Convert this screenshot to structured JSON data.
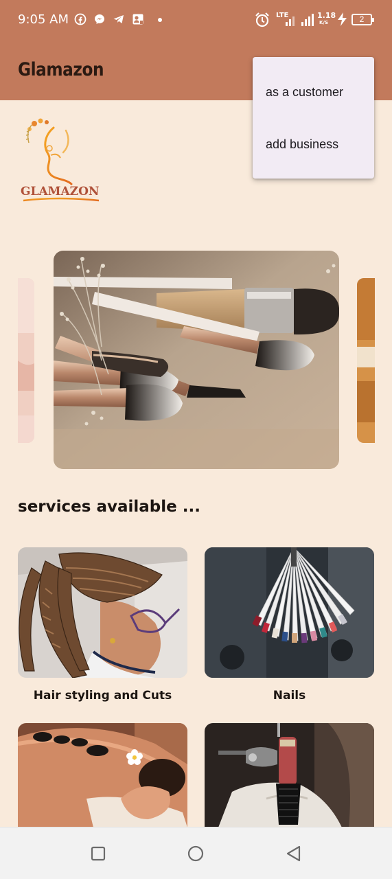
{
  "status_bar": {
    "time": "9:05 AM",
    "network_type": "LTE",
    "speed_value": "1.18",
    "speed_unit": "K/S",
    "battery_level": "2",
    "icons": [
      "facebook-icon",
      "messenger-icon",
      "telegram-icon",
      "contact-card-icon",
      "alarm-icon",
      "signal-icon",
      "charging-icon"
    ]
  },
  "app_bar": {
    "title": "Glamazon",
    "background_color": "#c27a5c"
  },
  "popup_menu": {
    "items": [
      {
        "label": "as a customer"
      },
      {
        "label": "add business"
      }
    ]
  },
  "logo": {
    "text": "GLAMAZON"
  },
  "carousel": {
    "current_image": "makeup-brushes",
    "prev_image": "spa-skin",
    "next_image": "food-plate"
  },
  "services": {
    "heading": "services available ...",
    "items": [
      {
        "label": "Hair styling and Cuts",
        "image": "braided-hair"
      },
      {
        "label": "Nails",
        "image": "nail-polish-swatches"
      },
      {
        "label": "",
        "image": "hot-stone-massage"
      },
      {
        "label": "",
        "image": "tattoo-machine"
      }
    ]
  },
  "nav_bar": {
    "buttons": [
      "recents-button",
      "home-button",
      "back-button"
    ]
  },
  "colors": {
    "brand": "#c27a5c",
    "background": "#f9eadb",
    "menu": "#f2ebf4"
  }
}
